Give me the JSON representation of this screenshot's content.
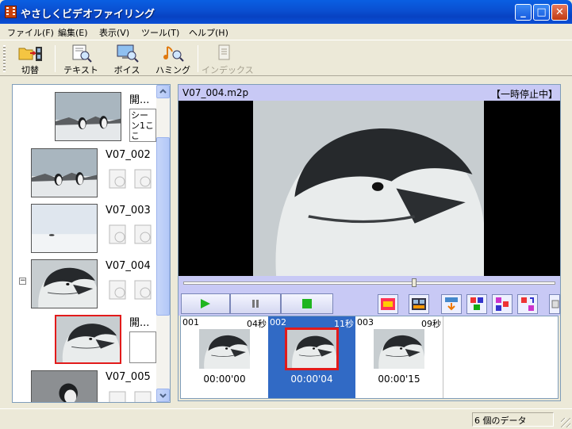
{
  "window": {
    "title": "やさしくビデオファイリング",
    "minimize": "_",
    "maximize": "□",
    "close": "✕"
  },
  "menu": [
    "ファイル(F)",
    "編集(E)",
    "表示(V)",
    "ツール(T)",
    "ヘルプ(H)"
  ],
  "toolbar": {
    "switch_label": "切替",
    "text_label": "テキスト",
    "voice_label": "ボイス",
    "humming_label": "ハミング",
    "index_label": "インデックス"
  },
  "tree": {
    "items": [
      {
        "name": "開...",
        "note": "シーン1ここ"
      },
      {
        "name": "V07_002"
      },
      {
        "name": "V07_003"
      },
      {
        "name": "V07_004"
      },
      {
        "name": "開...",
        "note": ""
      },
      {
        "name": "V07_005"
      }
    ],
    "expander": "−"
  },
  "player": {
    "filename": "V07_004.m2p",
    "status": "【一時停止中】",
    "seek_fraction": 0.62
  },
  "scenes": [
    {
      "number": "001",
      "duration": "04秒",
      "time": "00:00'00"
    },
    {
      "number": "002",
      "duration": "11秒",
      "time": "00:00'04"
    },
    {
      "number": "003",
      "duration": "09秒",
      "time": "00:00'15"
    }
  ],
  "statusbar": {
    "count": "6 個のデータ"
  },
  "colors": {
    "titlebar": "#0a4fd1",
    "panel_header": "#c8c9f5",
    "selected": "#316ac5",
    "highlight_border": "#e21b1b"
  }
}
